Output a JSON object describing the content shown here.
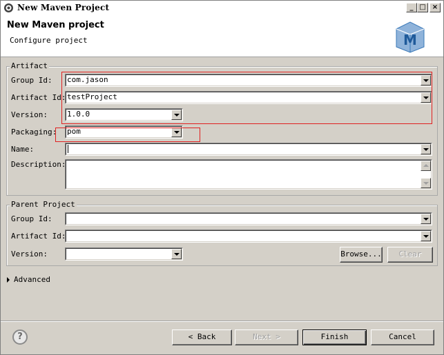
{
  "window": {
    "title": "New Maven Project",
    "minimize_glyph": "_",
    "maximize_glyph": "□",
    "close_glyph": "×"
  },
  "header": {
    "title": "New Maven project",
    "subtitle": "Configure project",
    "logo_letter": "M"
  },
  "artifact": {
    "legend": "Artifact",
    "group_id": {
      "label": "Group Id:",
      "value": "com.jason"
    },
    "artifact_id": {
      "label": "Artifact Id:",
      "value": "testProject"
    },
    "version": {
      "label": "Version:",
      "value": "1.0.0"
    },
    "packaging": {
      "label": "Packaging:",
      "value": "pom"
    },
    "name": {
      "label": "Name:",
      "value": ""
    },
    "description": {
      "label": "Description:",
      "value": ""
    }
  },
  "parent": {
    "legend": "Parent Project",
    "group_id": {
      "label": "Group Id:",
      "value": ""
    },
    "artifact_id": {
      "label": "Artifact Id:",
      "value": ""
    },
    "version": {
      "label": "Version:",
      "value": ""
    },
    "browse_label": "Browse...",
    "clear_label": "Clear"
  },
  "advanced": {
    "label": "Advanced"
  },
  "footer": {
    "help_glyph": "?",
    "back_label": "< Back",
    "next_label": "Next >",
    "finish_label": "Finish",
    "cancel_label": "Cancel"
  },
  "colors": {
    "highlight_box": "#e02020",
    "dialog_bg": "#d4d0c8",
    "logo_blue": "#3a78b8"
  }
}
